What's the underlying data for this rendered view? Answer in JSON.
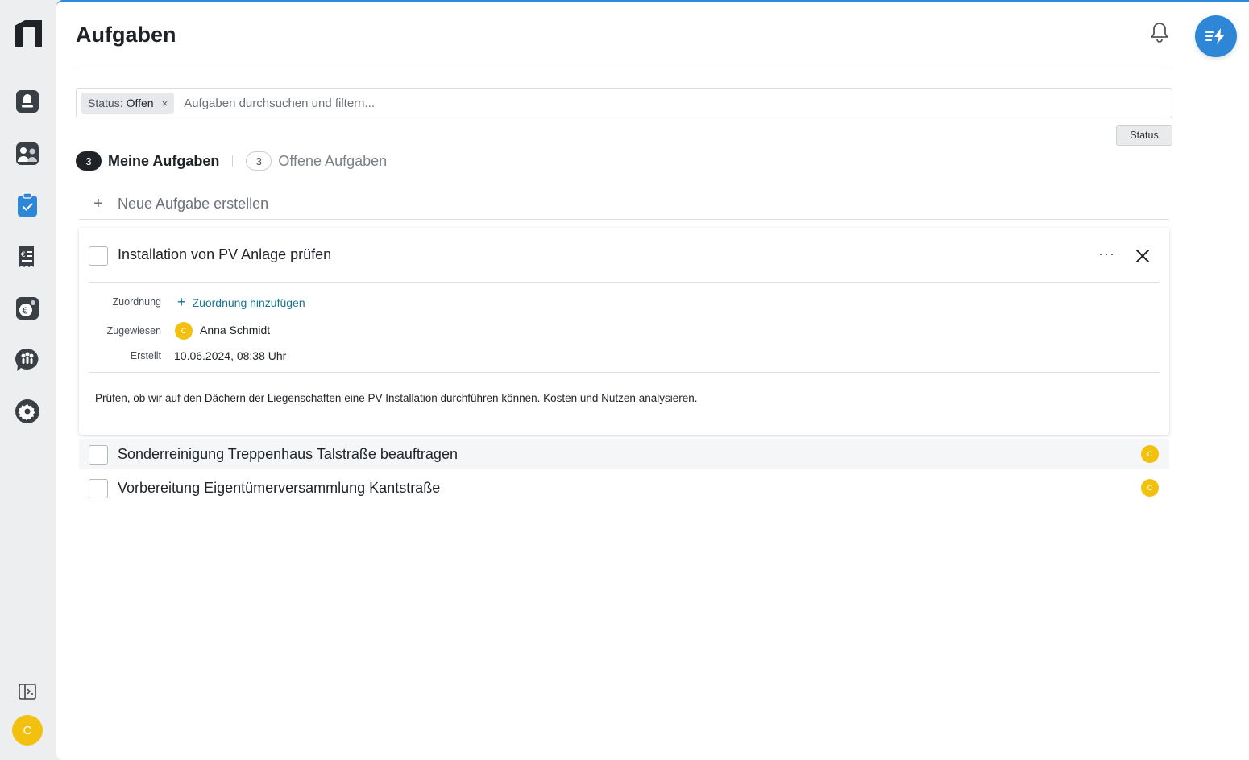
{
  "sidebar": {
    "nav": [
      {
        "name": "property-icon"
      },
      {
        "name": "people-icon"
      },
      {
        "name": "tasks-icon"
      },
      {
        "name": "invoice-icon"
      },
      {
        "name": "finance-icon"
      },
      {
        "name": "community-icon"
      },
      {
        "name": "settings-icon"
      }
    ],
    "active_index": 2,
    "user_initial": "C"
  },
  "header": {
    "title": "Aufgaben"
  },
  "search": {
    "chip_key": "Status:",
    "chip_value": "Offen",
    "chip_remove": "×",
    "placeholder": "Aufgaben durchsuchen und filtern..."
  },
  "status_button": "Status",
  "tabs": [
    {
      "count": "3",
      "label": "Meine Aufgaben",
      "active": true
    },
    {
      "count": "3",
      "label": "Offene Aufgaben",
      "active": false
    }
  ],
  "new_task": {
    "icon": "+",
    "label": "Neue Aufgabe erstellen"
  },
  "expanded_task": {
    "title": "Installation von PV Anlage prüfen",
    "more": "···",
    "fields": {
      "assignment_label": "Zuordnung",
      "assignment_action": "Zuordnung hinzufügen",
      "assignee_label": "Zugewiesen",
      "assignee_initial": "C",
      "assignee_name": "Anna Schmidt",
      "created_label": "Erstellt",
      "created_value": "10.06.2024, 08:38 Uhr"
    },
    "description": "Prüfen, ob wir auf den Dächern der Liegenschaften eine PV Installation durchführen können. Kosten und Nutzen analysieren."
  },
  "tasks": [
    {
      "title": "Sonderreinigung Treppenhaus Talstraße beauftragen",
      "assignee_initial": "C"
    },
    {
      "title": "Vorbereitung Eigentümerversammlung Kantstraße",
      "assignee_initial": "C"
    }
  ],
  "colors": {
    "accent": "#2d86d6",
    "avatar": "#f2c00f",
    "link": "#1a7490"
  }
}
